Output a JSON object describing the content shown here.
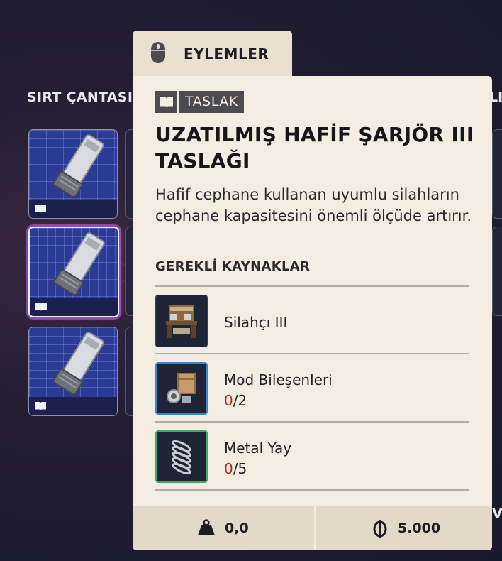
{
  "left_section": {
    "title": "SIRT ÇANTASI"
  },
  "right_section": {
    "title_fragment": "LI",
    "bottom_fragment": "VE"
  },
  "actions": {
    "label": "EYLEMLER"
  },
  "item": {
    "badge": "TASLAK",
    "title": "UZATILMIŞ HAFİF ŞARJÖR III TASLAĞI",
    "description": "Hafif cephane kullanan uyumlu silahların cephane kapasitesini önemli ölçüde artırır.",
    "requirements_heading": "GEREKLİ KAYNAKLAR",
    "requirements": [
      {
        "name": "Silahçı III",
        "have": "",
        "sep": "",
        "need": "",
        "icon": "workbench-icon"
      },
      {
        "name": "Mod Bileşenleri",
        "have": "0",
        "sep": "/",
        "need": "2",
        "icon": "mod-components-icon"
      },
      {
        "name": "Metal Yay",
        "have": "0",
        "sep": "/",
        "need": "5",
        "icon": "metal-spring-icon"
      }
    ],
    "weight": "0,0",
    "price": "5.000"
  },
  "colors": {
    "panel_bg": "#f2ece1",
    "accent_red": "#b02c20",
    "slot_blue": "#2b3a92"
  }
}
